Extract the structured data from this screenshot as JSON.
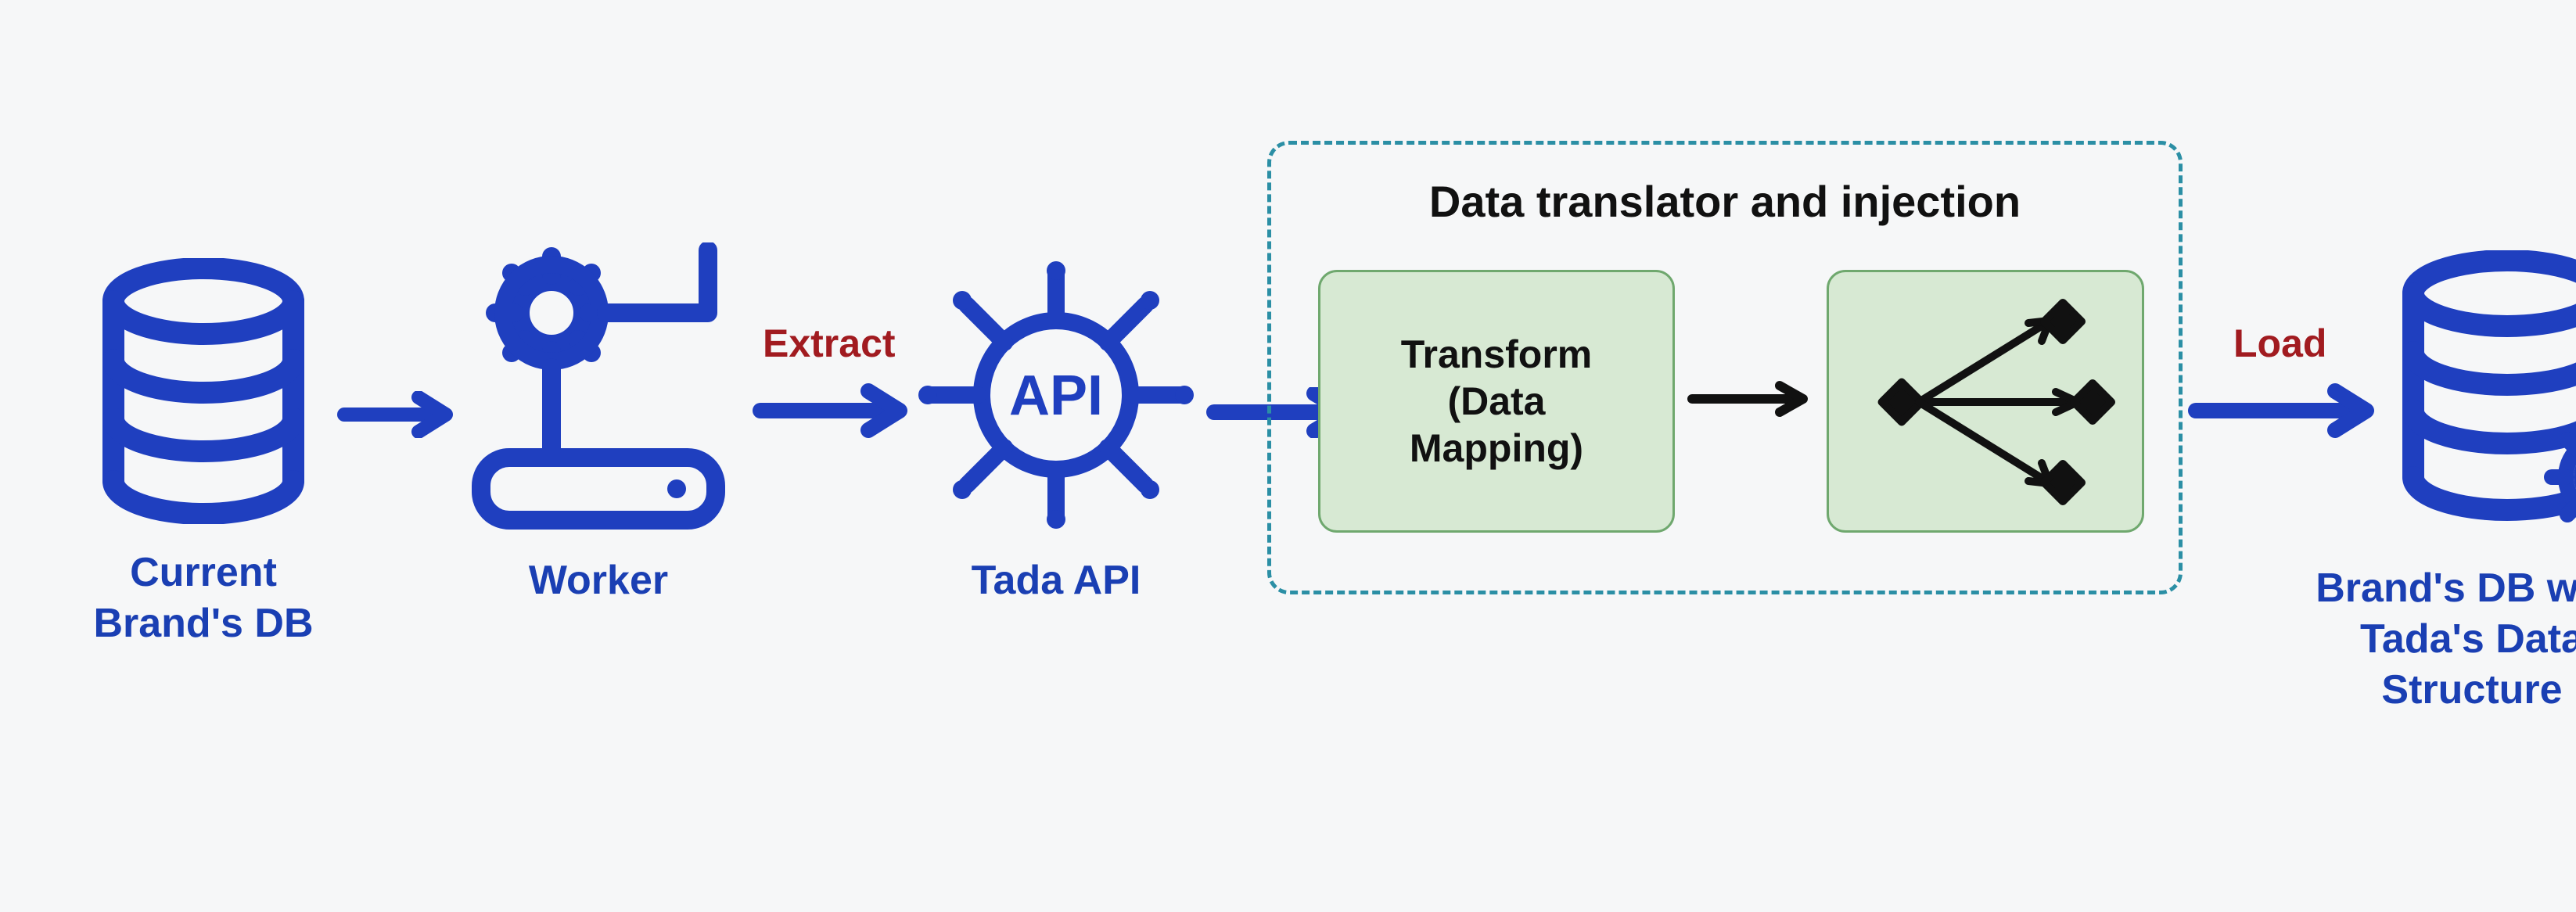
{
  "colors": {
    "primary": "#1f3fbf",
    "accent_text": "#a11b20",
    "stage_border": "#2b8fa5",
    "box_fill": "#d7e9d3",
    "box_stroke": "#6fa86e",
    "black": "#111111"
  },
  "nodes": {
    "source_db": {
      "label": "Current\nBrand's DB"
    },
    "worker": {
      "label": "Worker"
    },
    "api": {
      "label": "Tada API"
    },
    "target_db": {
      "label": "Brand's DB with\nTada's Data\nStructure"
    }
  },
  "edges": {
    "extract": {
      "label": "Extract"
    },
    "load": {
      "label": "Load"
    }
  },
  "stage": {
    "title": "Data translator and injection",
    "transform": {
      "label": "Transform\n(Data\nMapping)"
    }
  }
}
